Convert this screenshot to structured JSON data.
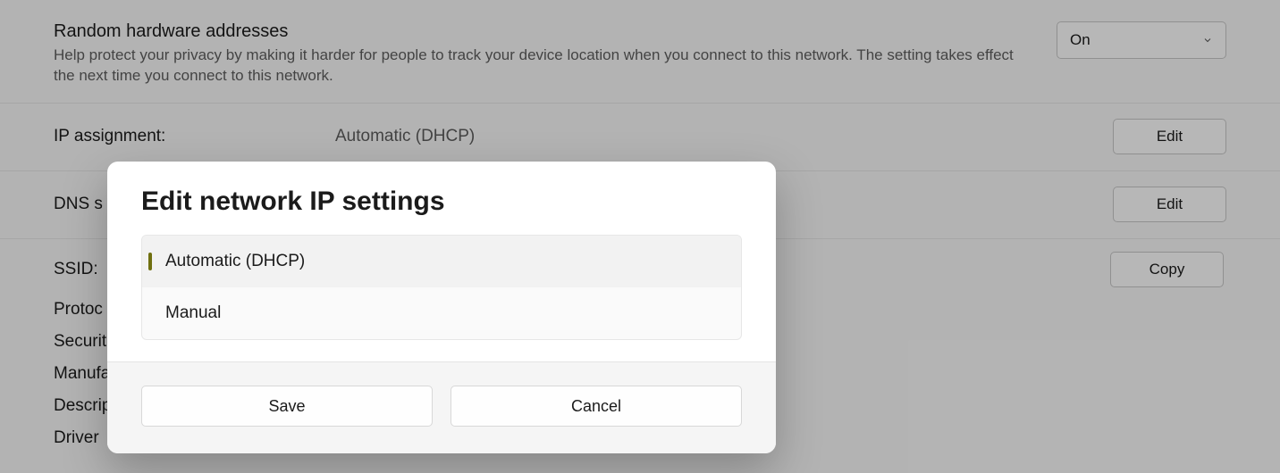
{
  "random": {
    "title": "Random hardware addresses",
    "desc": "Help protect your privacy by making it harder for people to track your device location when you connect to this network. The setting takes effect the next time you connect to this network.",
    "toggle_value": "On"
  },
  "ip_assignment": {
    "label": "IP assignment:",
    "value": "Automatic (DHCP)",
    "button": "Edit"
  },
  "dns": {
    "label": "DNS s",
    "button": "Edit"
  },
  "details": {
    "ssid_label": "SSID:",
    "protocol_label": "Protoc",
    "security_label": "Securit",
    "manufacturer_label": "Manufa",
    "description_label": "Descrip",
    "driver_label": "Driver",
    "copy_button": "Copy"
  },
  "dialog": {
    "title": "Edit network IP settings",
    "option_auto": "Automatic (DHCP)",
    "option_manual": "Manual",
    "save": "Save",
    "cancel": "Cancel"
  }
}
